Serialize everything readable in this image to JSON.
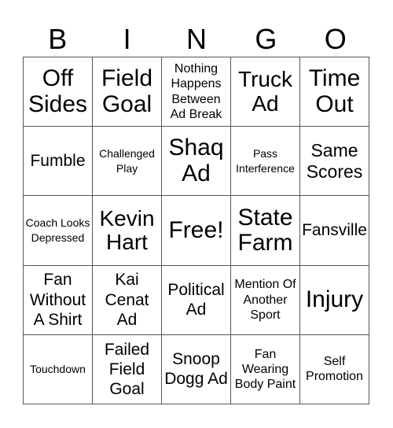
{
  "header": {
    "letters": [
      "B",
      "I",
      "N",
      "G",
      "O"
    ]
  },
  "card": {
    "rows": [
      [
        "Off Sides",
        "Field Goal",
        "Nothing Happens Between Ad Break",
        "Truck Ad",
        "Time Out"
      ],
      [
        "Fumble",
        "Challenged Play",
        "Shaq Ad",
        "Pass Interference",
        "Same Scores"
      ],
      [
        "Coach Looks Depressed",
        "Kevin Hart",
        "Free!",
        "State Farm",
        "Fansville"
      ],
      [
        "Fan Without A Shirt",
        "Kai Cenat Ad",
        "Political Ad",
        "Mention Of Another Sport",
        "Injury"
      ],
      [
        "Touchdown",
        "Failed Field Goal",
        "Snoop Dogg Ad",
        "Fan Wearing Body Paint",
        "Self Promotion"
      ]
    ]
  },
  "colors": {
    "grid_line": "#555555",
    "text": "#000000",
    "background": "#ffffff"
  }
}
